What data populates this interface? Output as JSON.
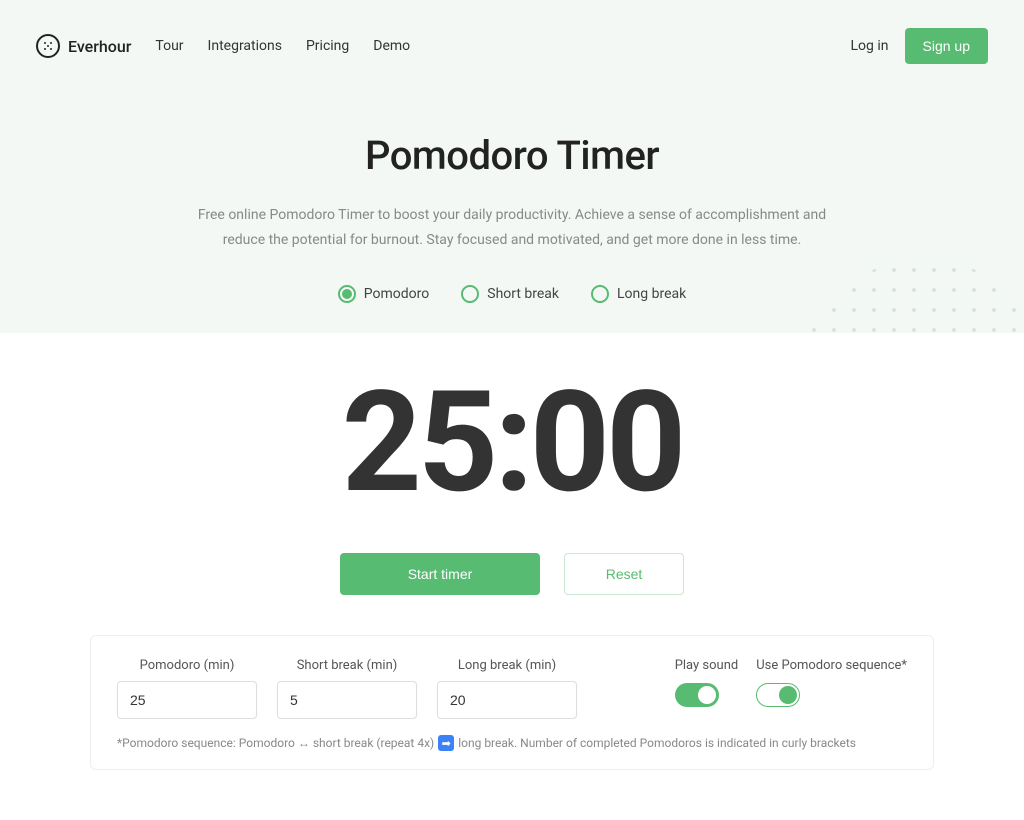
{
  "brand": "Everhour",
  "nav": {
    "tour": "Tour",
    "integrations": "Integrations",
    "pricing": "Pricing",
    "demo": "Demo"
  },
  "auth": {
    "login": "Log in",
    "signup": "Sign up"
  },
  "hero": {
    "title": "Pomodoro Timer",
    "description": "Free online Pomodoro Timer to boost your daily productivity. Achieve a sense of accomplishment and reduce the potential for burnout. Stay focused and motivated, and get more done in less time."
  },
  "modes": {
    "pomodoro": "Pomodoro",
    "short_break": "Short break",
    "long_break": "Long break"
  },
  "timer": {
    "display": "25:00",
    "start_label": "Start timer",
    "reset_label": "Reset"
  },
  "settings": {
    "pomodoro_label": "Pomodoro (min)",
    "pomodoro_value": "25",
    "short_break_label": "Short break (min)",
    "short_break_value": "5",
    "long_break_label": "Long break (min)",
    "long_break_value": "20",
    "play_sound_label": "Play sound",
    "sequence_label": "Use Pomodoro sequence*",
    "footnote_prefix": "*Pomodoro sequence: Pomodoro ↔ short break (repeat 4x)",
    "footnote_suffix": "long break. Number of completed Pomodoros is indicated in curly brackets"
  }
}
